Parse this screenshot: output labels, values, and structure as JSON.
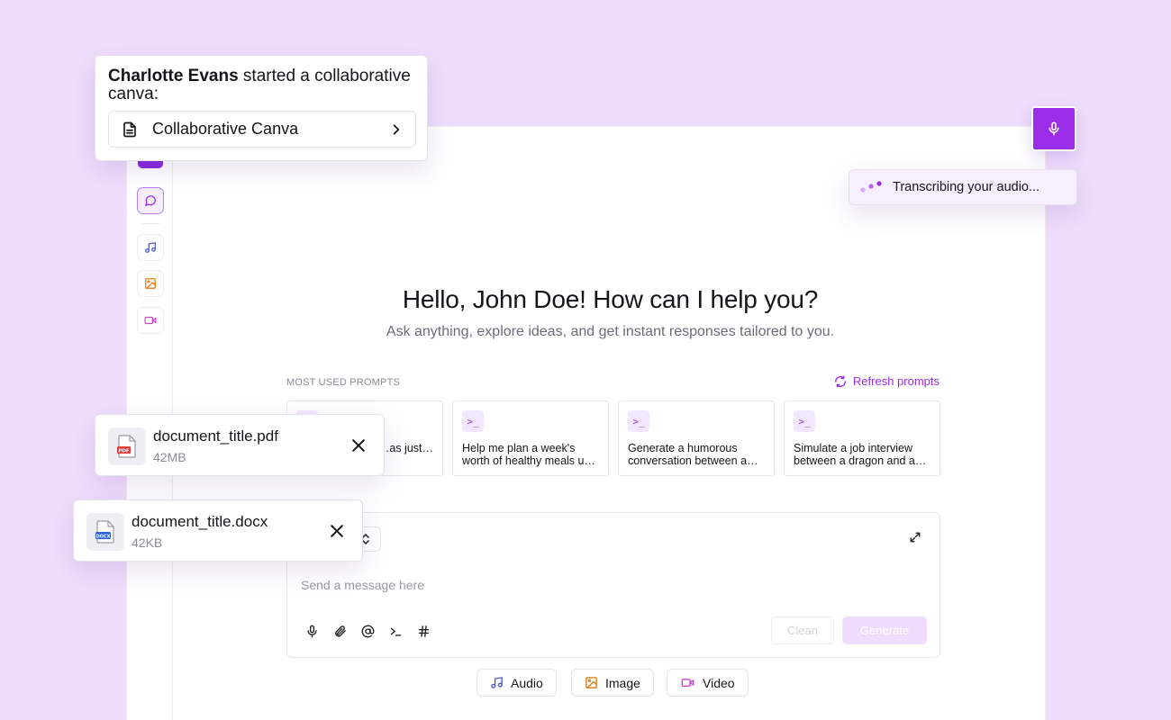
{
  "collab_popup": {
    "user_name": "Charlotte Evans",
    "message": " started a collaborative canva:",
    "link_label": "Collaborative Canva"
  },
  "transcribe": {
    "text": "Transcribing your audio..."
  },
  "main": {
    "greeting": "Hello, John Doe! How can I help you?",
    "subtitle": "Ask anything, explore ideas, and get instant responses tailored to you.",
    "most_used_label": "MOST USED PROMPTS",
    "refresh_label": "Refresh prompts",
    "prompts": [
      {
        "text": "…entry of …as just…"
      },
      {
        "text": "Help me plan a week's worth of healthy meals u…"
      },
      {
        "text": "Generate a humorous conversation between a…"
      },
      {
        "text": "Simulate a job interview between a dragon and a…"
      }
    ],
    "prompt_icon_glyph": ">_"
  },
  "composer": {
    "placeholder": "Send a message here",
    "clean_label": "Clean",
    "generate_label": "Generate",
    "tools": [
      "microphone-icon",
      "paperclip-icon",
      "at-icon",
      "terminal-icon",
      "hash-icon"
    ]
  },
  "modes": [
    {
      "label": "Audio",
      "icon": "music-note-icon"
    },
    {
      "label": "Image",
      "icon": "image-icon"
    },
    {
      "label": "Video",
      "icon": "video-icon"
    }
  ],
  "files": [
    {
      "name": "document_title.pdf",
      "size": "42MB",
      "type": "PDF"
    },
    {
      "name": "document_title.docx",
      "size": "42KB",
      "type": "DOCX"
    }
  ],
  "colors": {
    "accent": "#9b2ce8",
    "background": "#efddfd",
    "audio_icon": "#4f5bd5",
    "image_icon": "#e07b12",
    "video_icon": "#d43fd0",
    "pdf_badge": "#e53935",
    "docx_badge": "#2b63d9"
  }
}
